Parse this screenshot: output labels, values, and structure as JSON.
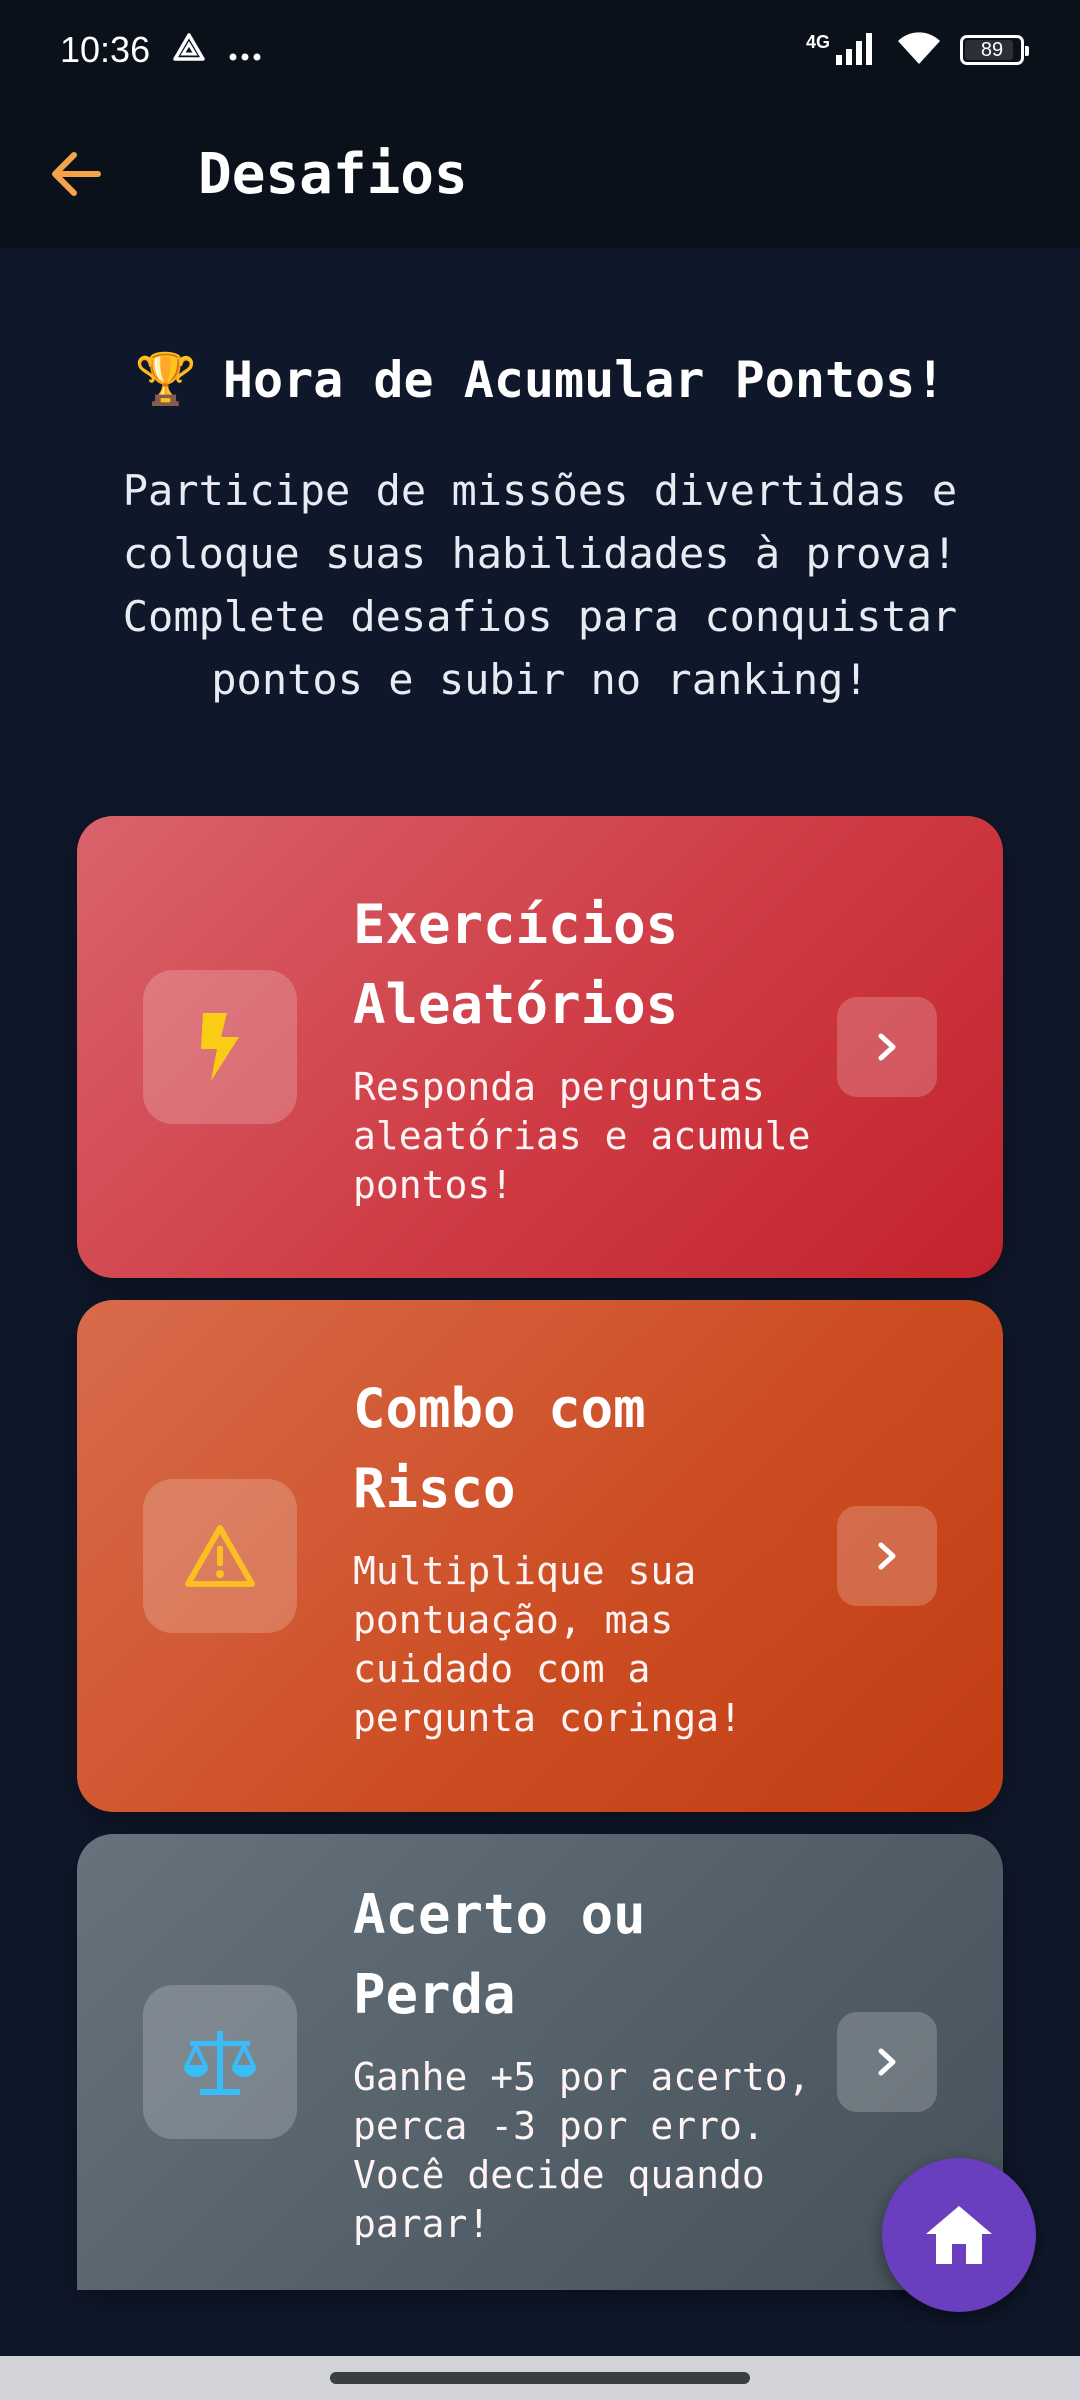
{
  "status_bar": {
    "time": "10:36",
    "network": "4G",
    "battery": "89",
    "icons": [
      "nav-triangle-icon",
      "more-dots-icon",
      "signal-icon",
      "wifi-icon",
      "battery-icon"
    ]
  },
  "app_bar": {
    "title": "Desafios",
    "back_icon": "arrow-left-icon",
    "accent": "#f5a34a"
  },
  "intro": {
    "emoji": "🏆",
    "title": "Hora de Acumular Pontos!",
    "text": "Participe de missões divertidas e\ncoloque suas habilidades à prova!\nComplete desafios para conquistar\npontos e subir no ranking!"
  },
  "challenges": [
    {
      "title": "Exercícios\nAleatórios",
      "description": "Responda perguntas\naleatórias e acumule\npontos!",
      "icon": "lightning-icon",
      "icon_color": "#facc15"
    },
    {
      "title": "Combo com\nRisco",
      "description": "Multiplique sua\npontuação, mas\ncuidado com a\npergunta coringa!",
      "icon": "warning-icon",
      "icon_color": "#fbbf24"
    },
    {
      "title": "Acerto ou\nPerda",
      "description": "Ganhe +5 por acerto,\nperca -3 por erro.\nVocê decide quando\nparar!",
      "icon": "scales-icon",
      "icon_color": "#38bdf8"
    }
  ],
  "fab": {
    "icon": "home-icon",
    "color": "#6a3fbf"
  }
}
